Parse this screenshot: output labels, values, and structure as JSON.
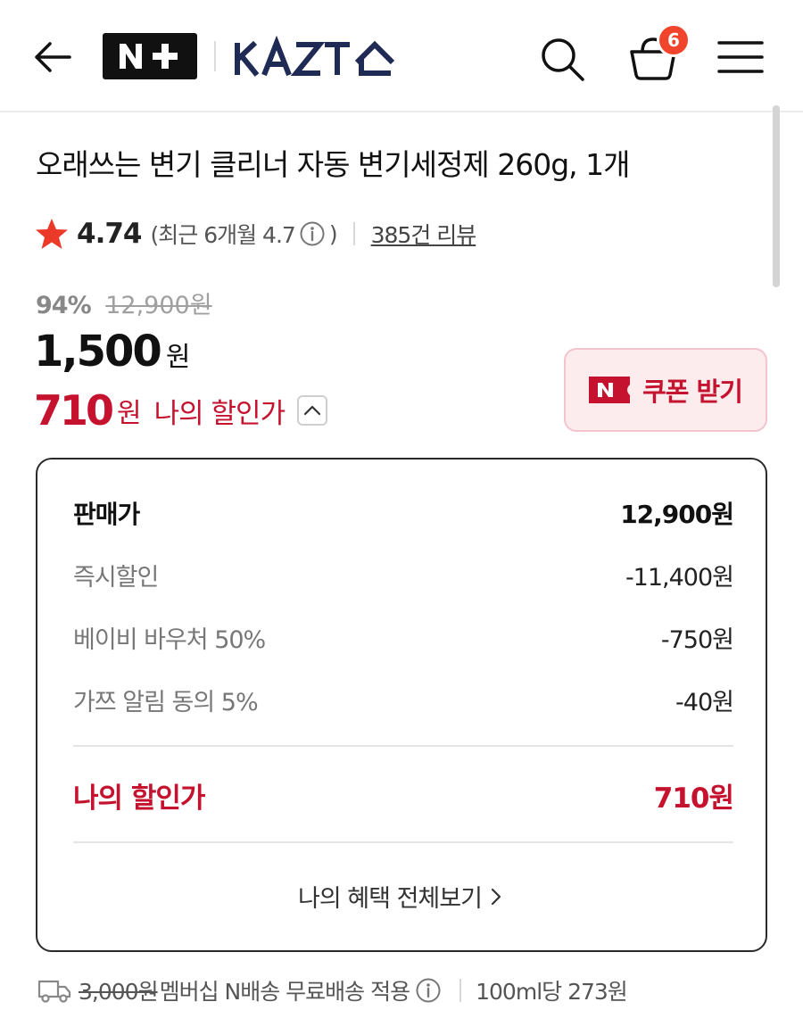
{
  "header": {
    "store_logo": "N+",
    "brand_logo": "KAZT",
    "cart_count": "6"
  },
  "product": {
    "title": "오래쓰는 변기 클리너 자동 변기세정제 260g, 1개"
  },
  "rating": {
    "score": "4.74",
    "recent_prefix": "(최근 6개월 4.7",
    "recent_suffix": ")",
    "review_count": "385건 리뷰"
  },
  "price": {
    "discount_rate": "94%",
    "original_price": "12,900원",
    "sale_price": "1,500",
    "sale_unit": "원",
    "my_price": "710",
    "my_price_unit": "원",
    "my_price_label": "나의 할인가"
  },
  "coupon": {
    "label": "쿠폰 받기"
  },
  "breakdown": {
    "rows": [
      {
        "label": "판매가",
        "value": "12,900원"
      },
      {
        "label": "즉시할인",
        "value": "-11,400원"
      },
      {
        "label": "베이비 바우처 50%",
        "value": "-750원"
      },
      {
        "label": "가쯔 알림 동의 5%",
        "value": "-40원"
      }
    ],
    "final": {
      "label": "나의 할인가",
      "value": "710원"
    },
    "view_all": "나의 혜택 전체보기"
  },
  "shipping": {
    "fee": "3,000원",
    "text": "멤버십 N배송 무료배송 적용",
    "unit_price": "100ml당 273원"
  },
  "colors": {
    "accent": "#c4122f",
    "badge": "#f0442c",
    "star": "#ec3a2a",
    "brand_navy": "#1f2a55"
  }
}
